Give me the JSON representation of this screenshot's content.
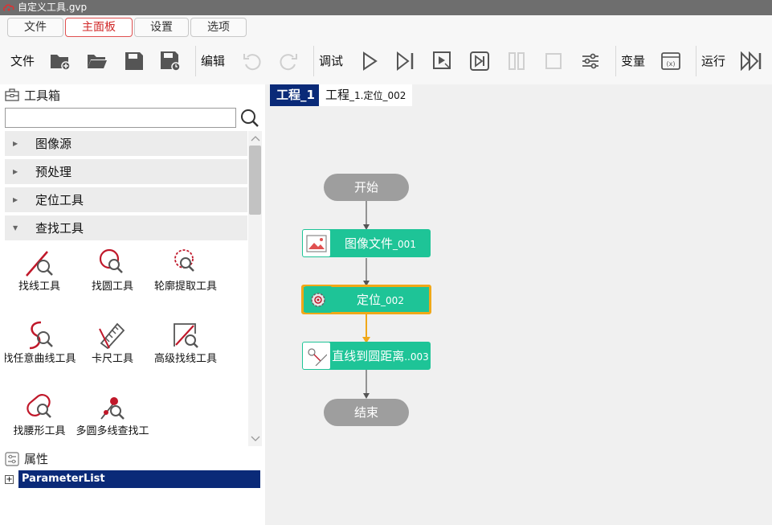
{
  "window": {
    "title": "自定义工具.gvp"
  },
  "menu": {
    "tabs": [
      "文件",
      "主面板",
      "设置",
      "选项"
    ],
    "active": "主面板"
  },
  "toolbar": {
    "file_label": "文件",
    "edit_label": "编辑",
    "debug_label": "调试",
    "variable_label": "变量",
    "run_label": "运行",
    "buttons": [
      "new-file-icon",
      "open-folder-icon",
      "save-icon",
      "save-as-icon",
      "undo-icon",
      "redo-icon",
      "play-icon",
      "step-icon",
      "step-out-icon",
      "skip-icon",
      "pause-icon",
      "stop-icon",
      "settings-sliders-icon",
      "variable-icon",
      "run-all-icon"
    ]
  },
  "toolbox": {
    "title": "工具箱",
    "search_value": "",
    "categories": [
      {
        "label": "图像源",
        "expanded": false
      },
      {
        "label": "预处理",
        "expanded": false
      },
      {
        "label": "定位工具",
        "expanded": false
      },
      {
        "label": "查找工具",
        "expanded": true
      }
    ],
    "tools": [
      {
        "label": "找线工具",
        "icon": "find-line-icon"
      },
      {
        "label": "找圆工具",
        "icon": "find-circle-icon"
      },
      {
        "label": "轮廓提取工具",
        "icon": "contour-extract-icon"
      },
      {
        "label": "找任意曲线工具",
        "icon": "find-curve-icon"
      },
      {
        "label": "卡尺工具",
        "icon": "caliper-icon"
      },
      {
        "label": "高级找线工具",
        "icon": "advanced-find-line-icon"
      },
      {
        "label": "找腰形工具",
        "icon": "find-waist-icon"
      },
      {
        "label": "多圆多线查找工具",
        "icon": "multi-circle-line-icon"
      }
    ]
  },
  "properties": {
    "title": "属性",
    "root_label": "ParameterList",
    "expand_symbol": "+"
  },
  "project": {
    "tabs": [
      {
        "main": "工程_1",
        "small": "",
        "active": true
      },
      {
        "main": "工程",
        "small": "_1.定位_002",
        "active": false
      }
    ],
    "nodes": {
      "start": "开始",
      "step1": {
        "main": "图像文件",
        "small": "_001"
      },
      "step2": {
        "main": "定位",
        "small": "_002"
      },
      "step3": {
        "main": "直线到圆距离",
        "small": "..003"
      },
      "end": "结束"
    }
  },
  "colors": {
    "accent_red": "#d02828",
    "node_green": "#1ec497",
    "node_gray": "#9e9e9e",
    "selection_orange": "#f0a818",
    "active_tab_navy": "#0a2a78"
  }
}
